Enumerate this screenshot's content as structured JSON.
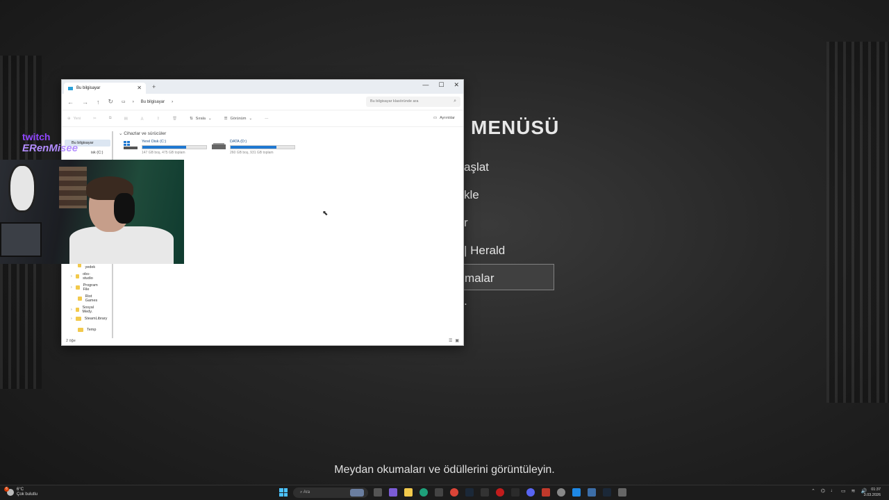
{
  "game": {
    "menu_title": "MENÜSÜ",
    "items": [
      "aşlat",
      "kle",
      "r",
      "| Herald",
      "malar",
      "."
    ],
    "subtitle": "Meydan okumaları ve ödüllerini görüntüleyin."
  },
  "overlay": {
    "twitch_logo": "twitch",
    "channel": "ERenMisee"
  },
  "explorer": {
    "tab_title": "Bu bilgisayar",
    "breadcrumb": "Bu bilgisayar",
    "search_placeholder": "Bu bilgisayar klasöründe ara",
    "toolbar": {
      "new": "Yeni",
      "sort": "Sırala",
      "view": "Görünüm",
      "more": "···",
      "details": "Ayrıntılar"
    },
    "sidebar": {
      "selected": "Bu bilgisayar",
      "partial_drive": "isk (C:)",
      "folders": [
        "obs yedek",
        "obs-studio",
        "Program File",
        "Riot Games",
        "Sosyal Medy.",
        "SteamLibrary",
        "Temp"
      ]
    },
    "section_title": "Cihazlar ve sürücüler",
    "drives": [
      {
        "name": "Yerel Disk (C:)",
        "free": "147 GB boş, 475 GB toplam",
        "used_fraction": 0.69
      },
      {
        "name": "DATA (D:)",
        "free": "260 GB boş, 931 GB toplam",
        "used_fraction": 0.72
      }
    ],
    "status": "2 öğe"
  },
  "taskbar": {
    "weather_temp": "6°C",
    "weather_desc": "Çok bulutlu",
    "weather_badge": "6",
    "search_placeholder": "Ara",
    "time": "01:37",
    "date": "3.03.2026"
  },
  "colors": {
    "accent": "#1f78d1",
    "twitch": "#9146ff"
  }
}
